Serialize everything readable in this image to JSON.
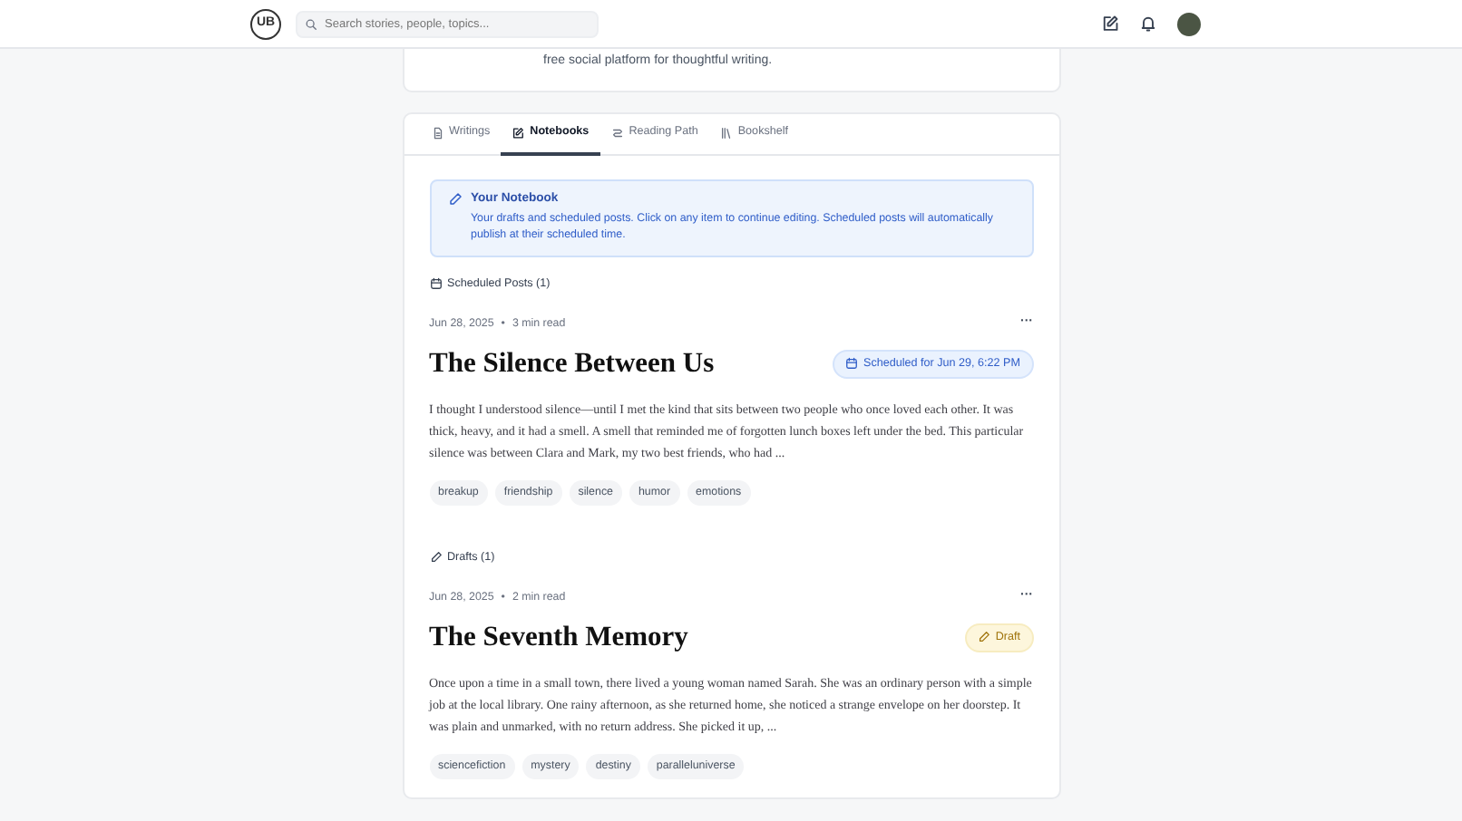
{
  "header": {
    "logo": "UB",
    "search": {
      "placeholder": "Search stories, people, topics..."
    }
  },
  "profile": {
    "bio_tail": "free social platform for thoughtful writing."
  },
  "tabs": [
    {
      "label": "Writings",
      "selected": false
    },
    {
      "label": "Notebooks",
      "selected": true
    },
    {
      "label": "Reading Path",
      "selected": false
    },
    {
      "label": "Bookshelf",
      "selected": false
    }
  ],
  "notice": {
    "title": "Your Notebook",
    "text": "Your drafts and scheduled posts. Click on any item to continue editing. Scheduled posts will automatically publish at their scheduled time."
  },
  "sections": [
    {
      "kind": "scheduled",
      "heading": "Scheduled Posts (1)",
      "posts": [
        {
          "date": "Jun 28, 2025",
          "separator": "•",
          "read_time": "3 min read",
          "more": "···",
          "title": "The Silence Between Us",
          "status": {
            "kind": "scheduled",
            "label": "Scheduled for Jun 29, 6:22 PM"
          },
          "excerpt": "I thought I understood silence—until I met the kind that sits between two people who once loved each other. It was thick, heavy, and it had a smell. A smell that reminded me of forgotten lunch boxes left under the bed. This particular silence was between Clara and Mark, my two best friends, who had ...",
          "tags": [
            "breakup",
            "friendship",
            "silence",
            "humor",
            "emotions"
          ]
        }
      ]
    },
    {
      "kind": "drafts",
      "heading": "Drafts (1)",
      "posts": [
        {
          "date": "Jun 28, 2025",
          "separator": "•",
          "read_time": "2 min read",
          "more": "···",
          "title": "The Seventh Memory",
          "status": {
            "kind": "draft",
            "label": "Draft"
          },
          "excerpt": "Once upon a time in a small town, there lived a young woman named Sarah. She was an ordinary person with a simple job at the local library. One rainy afternoon, as she returned home, she noticed a strange envelope on her doorstep. It was plain and unmarked, with no return address. She picked it up, ...",
          "tags": [
            "sciencefiction",
            "mystery",
            "destiny",
            "paralleluniverse"
          ]
        }
      ]
    }
  ]
}
